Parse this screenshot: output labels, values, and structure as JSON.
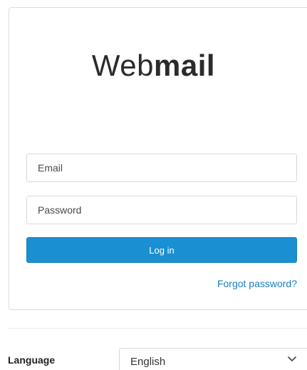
{
  "logo": {
    "light": "Web",
    "bold": "mail"
  },
  "form": {
    "email_placeholder": "Email",
    "password_placeholder": "Password",
    "login_label": "Log in",
    "forgot_label": "Forgot password?"
  },
  "language": {
    "label": "Language",
    "selected": "English",
    "icon": "chevron-down-icon"
  },
  "colors": {
    "accent": "#1a8fd1",
    "link": "#1a7ec0",
    "border": "#d6dadd"
  }
}
